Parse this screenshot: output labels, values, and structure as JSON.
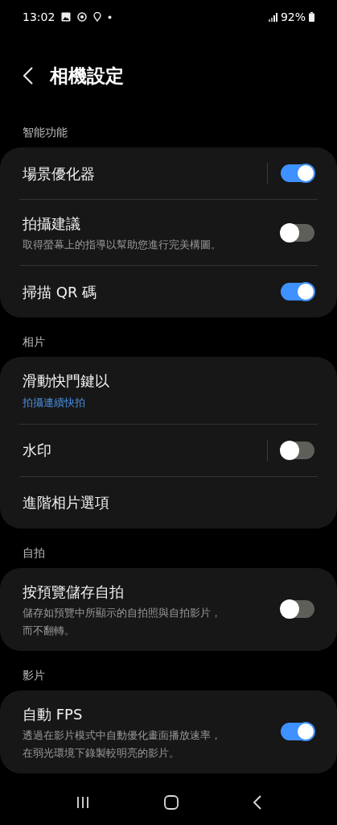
{
  "status_bar": {
    "time": "13:02",
    "battery": "92%"
  },
  "header": {
    "title": "相機設定"
  },
  "sections": [
    {
      "title": "智能功能",
      "items": [
        {
          "kind": "toggle",
          "label": "場景優化器",
          "on": true,
          "separator": true
        },
        {
          "kind": "toggle",
          "label": "拍攝建議",
          "description": [
            "取得螢幕上的指導以幫助您進行完美構圖。"
          ],
          "on": false,
          "separator": false
        },
        {
          "kind": "toggle",
          "label": "掃描 QR 碼",
          "on": true,
          "separator": false
        }
      ]
    },
    {
      "title": "相片",
      "items": [
        {
          "kind": "value",
          "label": "滑動快門鍵以",
          "value": "拍攝連續快拍"
        },
        {
          "kind": "toggle",
          "label": "水印",
          "on": false,
          "separator": true
        },
        {
          "kind": "link",
          "label": "進階相片選項"
        }
      ]
    },
    {
      "title": "自拍",
      "items": [
        {
          "kind": "toggle",
          "label": "按預覽儲存自拍",
          "description": [
            "儲存如預覽中所顯示的自拍照與自拍影片，",
            "而不翻轉。"
          ],
          "on": false,
          "separator": false
        }
      ]
    },
    {
      "title": "影片",
      "items": [
        {
          "kind": "toggle",
          "label": "自動 FPS",
          "description": [
            "透過在影片模式中自動優化畫面播放速率，",
            "在弱光環境下錄製較明亮的影片。"
          ],
          "on": true,
          "separator": false
        }
      ]
    }
  ]
}
